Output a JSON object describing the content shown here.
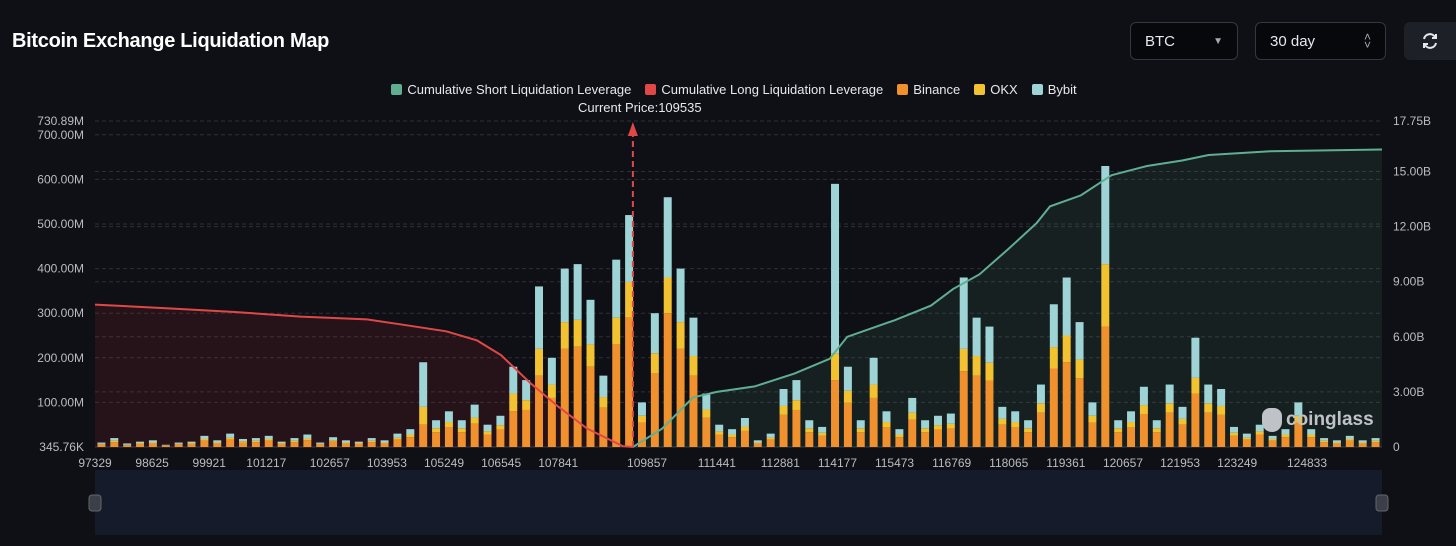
{
  "header": {
    "title": "Bitcoin Exchange Liquidation Map"
  },
  "controls": {
    "coin_select": "BTC",
    "range_select": "30 day",
    "refresh_icon": "refresh-icon"
  },
  "watermark": "coinglass",
  "colors": {
    "short": "#5fae92",
    "long": "#e04848",
    "binance": "#f0912e",
    "okx": "#f2c230",
    "bybit": "#9fd4d6"
  },
  "chart_data": {
    "type": "bar",
    "title": "Bitcoin Exchange Liquidation Map",
    "current_price_label": "Current Price:109535",
    "current_price": 109535,
    "legend": [
      "Cumulative Short Liquidation Leverage",
      "Cumulative Long Liquidation Leverage",
      "Binance",
      "OKX",
      "Bybit"
    ],
    "legend_placement": "top-center",
    "x_range": [
      97329,
      126535
    ],
    "x_ticks": [
      97329,
      98625,
      99921,
      101217,
      102657,
      103953,
      105249,
      106545,
      107841,
      109857,
      111441,
      112881,
      114177,
      115473,
      116769,
      118065,
      119361,
      120657,
      121953,
      123249,
      124833
    ],
    "y_left": {
      "unit": "M",
      "range": [
        0,
        730.89
      ],
      "ticks": [
        {
          "v": 0,
          "label": "345.76K"
        },
        {
          "v": 100,
          "label": "100.00M"
        },
        {
          "v": 200,
          "label": "200.00M"
        },
        {
          "v": 300,
          "label": "300.00M"
        },
        {
          "v": 400,
          "label": "400.00M"
        },
        {
          "v": 500,
          "label": "500.00M"
        },
        {
          "v": 600,
          "label": "600.00M"
        },
        {
          "v": 700,
          "label": "700.00M"
        },
        {
          "v": 730.89,
          "label": "730.89M"
        }
      ]
    },
    "y_right": {
      "unit": "B",
      "range": [
        0,
        17.75
      ],
      "ticks": [
        {
          "v": 0,
          "label": "0"
        },
        {
          "v": 3,
          "label": "3.00B"
        },
        {
          "v": 6,
          "label": "6.00B"
        },
        {
          "v": 9,
          "label": "9.00B"
        },
        {
          "v": 12,
          "label": "12.00B"
        },
        {
          "v": 15,
          "label": "15.00B"
        },
        {
          "v": 17.75,
          "label": "17.75B"
        }
      ]
    },
    "bar_count": 100,
    "series": [
      {
        "name": "Binance",
        "values": [
          6,
          11,
          4,
          7,
          8,
          3,
          6,
          7,
          14,
          8,
          17,
          10,
          11,
          14,
          7,
          11,
          15,
          6,
          12,
          8,
          7,
          11,
          8,
          17,
          22,
          50,
          33,
          44,
          33,
          52,
          28,
          39,
          80,
          83,
          160,
          110,
          220,
          225,
          180,
          88,
          230,
          290,
          55,
          165,
          300,
          220,
          160,
          66,
          28,
          22,
          36,
          8,
          17,
          72,
          83,
          33,
          25,
          150,
          99,
          33,
          110,
          44,
          22,
          61,
          33,
          39,
          41,
          170,
          160,
          149,
          50,
          44,
          33,
          77,
          176,
          190,
          154,
          55,
          270,
          33,
          44,
          74,
          33,
          77,
          50,
          120,
          77,
          72,
          25,
          17,
          28,
          14,
          22,
          55,
          22,
          11,
          8,
          14,
          8,
          11
        ]
      },
      {
        "name": "OKX",
        "values": [
          1,
          3,
          1,
          2,
          2,
          1,
          1,
          2,
          4,
          2,
          4,
          3,
          3,
          4,
          2,
          3,
          4,
          1,
          3,
          2,
          2,
          3,
          2,
          4,
          6,
          40,
          9,
          12,
          9,
          14,
          7,
          10,
          40,
          22,
          60,
          30,
          60,
          60,
          50,
          24,
          60,
          80,
          15,
          45,
          80,
          60,
          44,
          18,
          7,
          6,
          10,
          2,
          4,
          20,
          22,
          9,
          7,
          60,
          27,
          9,
          30,
          12,
          6,
          16,
          9,
          10,
          11,
          50,
          44,
          40,
          13,
          12,
          9,
          21,
          48,
          60,
          42,
          15,
          140,
          9,
          12,
          20,
          9,
          21,
          13,
          35,
          21,
          20,
          7,
          4,
          7,
          4,
          6,
          15,
          6,
          3,
          2,
          4,
          2,
          3
        ]
      },
      {
        "name": "Bybit",
        "values": [
          3,
          6,
          3,
          3,
          5,
          1,
          3,
          3,
          7,
          5,
          9,
          5,
          6,
          7,
          3,
          6,
          9,
          3,
          7,
          5,
          3,
          6,
          5,
          9,
          12,
          100,
          18,
          24,
          18,
          29,
          15,
          21,
          60,
          45,
          140,
          60,
          120,
          125,
          100,
          48,
          130,
          150,
          30,
          90,
          180,
          120,
          86,
          36,
          15,
          12,
          19,
          5,
          9,
          38,
          45,
          18,
          13,
          380,
          54,
          18,
          60,
          24,
          12,
          33,
          18,
          21,
          23,
          160,
          86,
          81,
          27,
          24,
          18,
          42,
          96,
          130,
          84,
          30,
          220,
          18,
          24,
          41,
          18,
          42,
          27,
          90,
          42,
          38,
          13,
          9,
          15,
          7,
          12,
          30,
          12,
          6,
          5,
          7,
          5,
          6
        ]
      }
    ],
    "cumulative_long_B": [
      [
        97329,
        7.75
      ],
      [
        99000,
        7.55
      ],
      [
        100500,
        7.35
      ],
      [
        102000,
        7.1
      ],
      [
        103500,
        6.95
      ],
      [
        104200,
        6.7
      ],
      [
        105300,
        6.3
      ],
      [
        106000,
        5.8
      ],
      [
        106545,
        5.0
      ],
      [
        107200,
        3.5
      ],
      [
        107841,
        2.2
      ],
      [
        108500,
        1.0
      ],
      [
        109300,
        0.05
      ],
      [
        109535,
        0
      ]
    ],
    "cumulative_short_B": [
      [
        109535,
        0
      ],
      [
        110200,
        1.0
      ],
      [
        110900,
        2.7
      ],
      [
        111441,
        3.0
      ],
      [
        112300,
        3.3
      ],
      [
        113200,
        4.0
      ],
      [
        114000,
        4.8
      ],
      [
        114400,
        6.0
      ],
      [
        115473,
        6.9
      ],
      [
        116300,
        7.7
      ],
      [
        116800,
        8.6
      ],
      [
        117400,
        9.4
      ],
      [
        118065,
        10.8
      ],
      [
        118700,
        12.2
      ],
      [
        119000,
        13.1
      ],
      [
        119700,
        13.7
      ],
      [
        120400,
        14.8
      ],
      [
        121200,
        15.3
      ],
      [
        122000,
        15.6
      ],
      [
        122600,
        15.9
      ],
      [
        124000,
        16.1
      ],
      [
        126535,
        16.2
      ]
    ]
  }
}
